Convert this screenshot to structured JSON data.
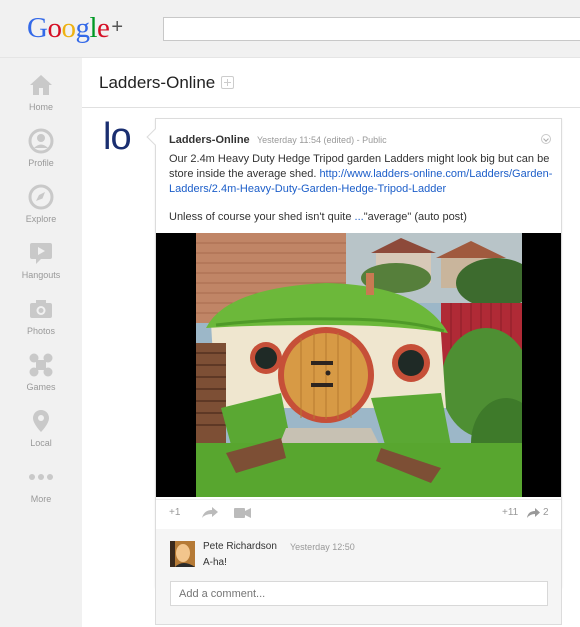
{
  "brand": {
    "logo_letters": [
      "G",
      "o",
      "o",
      "g",
      "l",
      "e"
    ],
    "logo_colors": [
      "#3369e8",
      "#d50f25",
      "#eeb211",
      "#3369e8",
      "#009925",
      "#d50f25"
    ],
    "logo_plus": "+"
  },
  "search": {
    "placeholder": ""
  },
  "nav": {
    "items": [
      {
        "label": "Home",
        "icon": "home-icon"
      },
      {
        "label": "Profile",
        "icon": "profile-icon"
      },
      {
        "label": "Explore",
        "icon": "compass-icon"
      },
      {
        "label": "Hangouts",
        "icon": "hangouts-icon"
      },
      {
        "label": "Photos",
        "icon": "camera-icon"
      },
      {
        "label": "Games",
        "icon": "games-icon"
      },
      {
        "label": "Local",
        "icon": "location-pin-icon"
      },
      {
        "label": "More",
        "icon": "more-dots-icon"
      }
    ]
  },
  "page": {
    "title": "Ladders-Online",
    "avatar_text": "lo"
  },
  "post": {
    "author": "Ladders-Online",
    "meta": "Yesterday 11:54 (edited)  -  Public",
    "text_before_link": "Our 2.4m Heavy Duty Hedge Tripod garden Ladders might look big but can be store inside the average shed.  ",
    "link": "http://www.ladders-online.com/Ladders/Garden-Ladders/2.4m-Heavy-Duty-Garden-Hedge-Tripod-Ladder",
    "text2_before": "Unless of course your shed isn't quite ",
    "text2_link": "...",
    "text2_after": "\"average\" (auto post)",
    "image_alt": "Hobbit-style garden shed with grass roof and round door",
    "actions": {
      "plus_one": "+1",
      "plus_count": "+11",
      "share_count": "2"
    }
  },
  "comments": [
    {
      "author": "Pete Richardson",
      "time": "Yesterday 12:50",
      "text": "A-ha!"
    }
  ],
  "comment_box": {
    "placeholder": "Add a comment..."
  },
  "colors": {
    "link": "#1c5ec9",
    "nav_icon": "#c9c9c9"
  }
}
